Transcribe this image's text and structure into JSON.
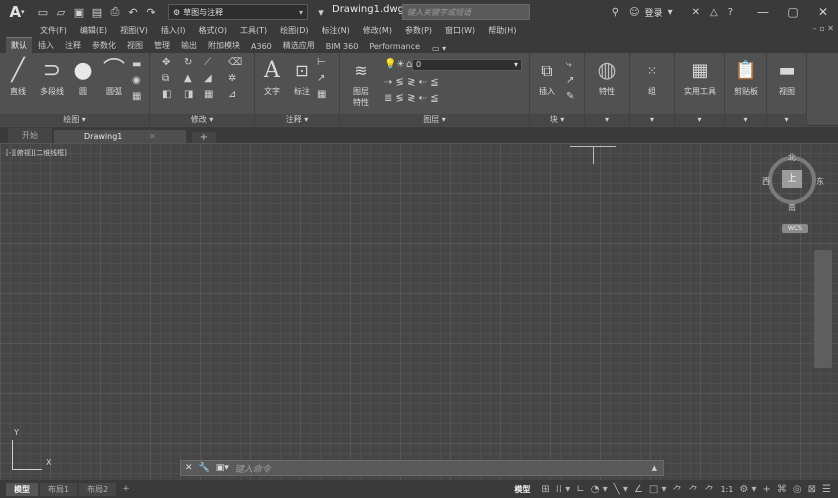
{
  "titlebar": {
    "logo": "A",
    "workspace": "草图与注释",
    "document_title": "Drawing1.dwg",
    "search_placeholder": "键入关键字或短语",
    "login": "登录"
  },
  "menubar": {
    "items": [
      "文件(F)",
      "编辑(E)",
      "视图(V)",
      "插入(I)",
      "格式(O)",
      "工具(T)",
      "绘图(D)",
      "标注(N)",
      "修改(M)",
      "参数(P)",
      "窗口(W)",
      "帮助(H)"
    ]
  },
  "ribbon_tabs": {
    "items": [
      "默认",
      "插入",
      "注释",
      "参数化",
      "视图",
      "管理",
      "输出",
      "附加模块",
      "A360",
      "精选应用",
      "BIM 360",
      "Performance"
    ],
    "active": "默认"
  },
  "ribbon": {
    "draw": {
      "line": "直线",
      "polyline": "多段线",
      "circle": "圆",
      "arc": "圆弧",
      "panel_label": "绘图 ▾"
    },
    "modify": {
      "panel_label": "修改 ▾"
    },
    "annotation": {
      "text": "文字",
      "dimension": "标注",
      "panel_label": "注释 ▾"
    },
    "layers": {
      "layer_props_1": "图层",
      "layer_props_2": "特性",
      "current_layer": "0",
      "panel_label": "图层 ▾"
    },
    "block": {
      "insert": "插入",
      "panel_label": "块 ▾"
    },
    "properties": {
      "label": "特性",
      "panel_label": "▾"
    },
    "groups": {
      "label": "组",
      "panel_label": "▾"
    },
    "utilities": {
      "label": "实用工具",
      "panel_label": "▾"
    },
    "clipboard": {
      "label": "剪贴板",
      "panel_label": "▾"
    },
    "view": {
      "label": "视图",
      "panel_label": "▾"
    }
  },
  "file_tabs": {
    "start": "开始",
    "drawing": "Drawing1"
  },
  "canvas": {
    "viewport_label": "[-][俯视][二维线框]",
    "viewcube": {
      "top": "上",
      "north": "北",
      "south": "南",
      "east": "东",
      "west": "西"
    },
    "wcs": "WCS",
    "ucs_x": "X",
    "ucs_y": "Y"
  },
  "command_line": {
    "placeholder": "键入命令"
  },
  "statusbar": {
    "layout_tabs": [
      "模型",
      "布局1",
      "布局2"
    ],
    "model_label": "模型",
    "scale": "1:1"
  }
}
